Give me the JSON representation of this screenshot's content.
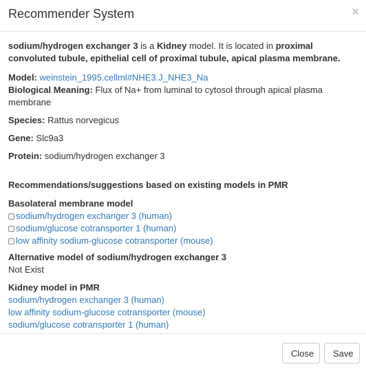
{
  "header": {
    "title": "Recommender System",
    "close_symbol": "×"
  },
  "intro": {
    "entity": "sodium/hydrogen exchanger 3",
    "is_a": " is a ",
    "organ": "Kidney",
    "model_located": " model. It is located in ",
    "locations": "proximal convoluted tubule, epithelial cell of proximal tubule, apical plasma membrane",
    "period": "."
  },
  "details": {
    "model_label": "Model:",
    "model_link": "weinstein_1995.cellml#NHE3.J_NHE3_Na",
    "meaning_label": "Biological Meaning:",
    "meaning_value": "Flux of Na+ from luminal to cytosol through apical plasma membrane",
    "species_label": "Species:",
    "species_value": "Rattus norvegicus",
    "gene_label": "Gene:",
    "gene_value": "Slc9a3",
    "protein_label": "Protein:",
    "protein_value": "sodium/hydrogen exchanger 3"
  },
  "recommendations": {
    "heading": "Recommendations/suggestions based on existing models in PMR",
    "basolateral": {
      "title": "Basolateral membrane model",
      "items": [
        "sodium/hydrogen exchanger 3 (human)",
        "sodium/glucose cotransporter 1 (human)",
        "low affinity sodium-glucose cotransporter (mouse)"
      ]
    },
    "alternative": {
      "title": "Alternative model of sodium/hydrogen exchanger 3",
      "value": "Not Exist"
    },
    "kidney": {
      "title": "Kidney model in PMR",
      "items": [
        "sodium/hydrogen exchanger 3 (human)",
        "low affinity sodium-glucose cotransporter (mouse)",
        "sodium/glucose cotransporter 1 (human)"
      ]
    }
  },
  "footer": {
    "close_label": "Close",
    "save_label": "Save"
  },
  "colors": {
    "link": "#337ab7",
    "text": "#333333",
    "border": "#e5e5e5"
  }
}
